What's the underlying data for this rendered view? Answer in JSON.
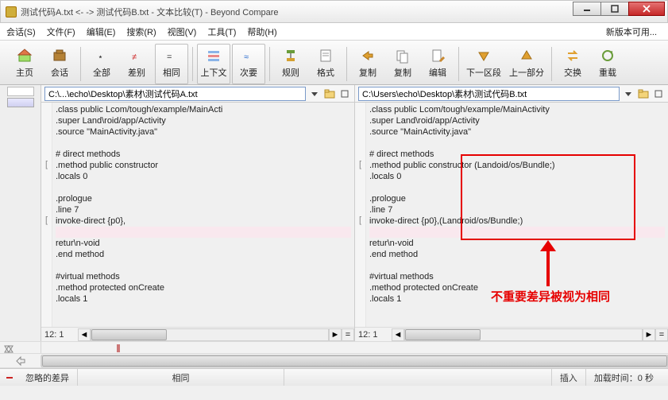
{
  "window": {
    "title": "测试代码A.txt <- -> 测试代码B.txt - 文本比较(T) - Beyond Compare"
  },
  "menu": {
    "session": "会话(S)",
    "file": "文件(F)",
    "edit": "编辑(E)",
    "search": "搜索(R)",
    "view": "视图(V)",
    "tools": "工具(T)",
    "help": "帮助(H)",
    "update": "新版本可用..."
  },
  "toolbar": {
    "home": "主页",
    "sessions": "会话",
    "all": "全部",
    "diff": "差别",
    "same": "相同",
    "context": "上下文",
    "minor": "次要",
    "rules": "规则",
    "format": "格式",
    "copyL": "复制",
    "copyR": "复制",
    "editBtn": "编辑",
    "nextSec": "下一区段",
    "prevSec": "上一部分",
    "swap": "交换",
    "reload": "重载"
  },
  "left": {
    "path": "C:\\...\\echo\\Desktop\\素材\\测试代码A.txt",
    "lines": [
      {
        "t": ".class public Lcom/tough/example/MainActi"
      },
      {
        "t": ".super Land\\roid/app/Activity"
      },
      {
        "t": ".source \"MainActivity.java\""
      },
      {
        "t": ""
      },
      {
        "t": "# direct methods"
      },
      {
        "t": ".method public constructor",
        "m": "["
      },
      {
        "t": ".locals 0"
      },
      {
        "t": ""
      },
      {
        "t": ".prologue"
      },
      {
        "t": ".line 7"
      },
      {
        "t": "invoke-direct {p0},",
        "m": "["
      },
      {
        "t": "",
        "d": true
      },
      {
        "t": "retur\\n-void"
      },
      {
        "t": ".end method"
      },
      {
        "t": ""
      },
      {
        "t": "#virtual methods"
      },
      {
        "t": ".method protected onCreate"
      },
      {
        "t": ".locals 1",
        "cut": true
      }
    ],
    "pos": "12: 1"
  },
  "right": {
    "path": "C:\\Users\\echo\\Desktop\\素材\\测试代码B.txt",
    "lines": [
      {
        "t": ".class public Lcom/tough/example/MainActivity"
      },
      {
        "t": ".super Land\\roid/app/Activity"
      },
      {
        "t": ".source \"MainActivity.java\""
      },
      {
        "t": ""
      },
      {
        "t": "# direct methods"
      },
      {
        "t": ".method public constructor (Landoid/os/Bundle;)",
        "m": "["
      },
      {
        "t": ".locals 0"
      },
      {
        "t": ""
      },
      {
        "t": ".prologue"
      },
      {
        "t": ".line 7"
      },
      {
        "t": "invoke-direct {p0},(Landroid/os/Bundle;)",
        "m": "["
      },
      {
        "t": "",
        "d": true
      },
      {
        "t": "retur\\n-void"
      },
      {
        "t": ".end method"
      },
      {
        "t": ""
      },
      {
        "t": "#virtual methods"
      },
      {
        "t": ".method protected onCreate"
      },
      {
        "t": ".locals 1",
        "cut": true
      }
    ],
    "pos": "12: 1"
  },
  "status": {
    "ignore": "忽略的差异",
    "same": "相同",
    "insert": "插入",
    "elapsed": "加载时间：0 秒"
  },
  "annotation": "不重要差异被视为相同"
}
